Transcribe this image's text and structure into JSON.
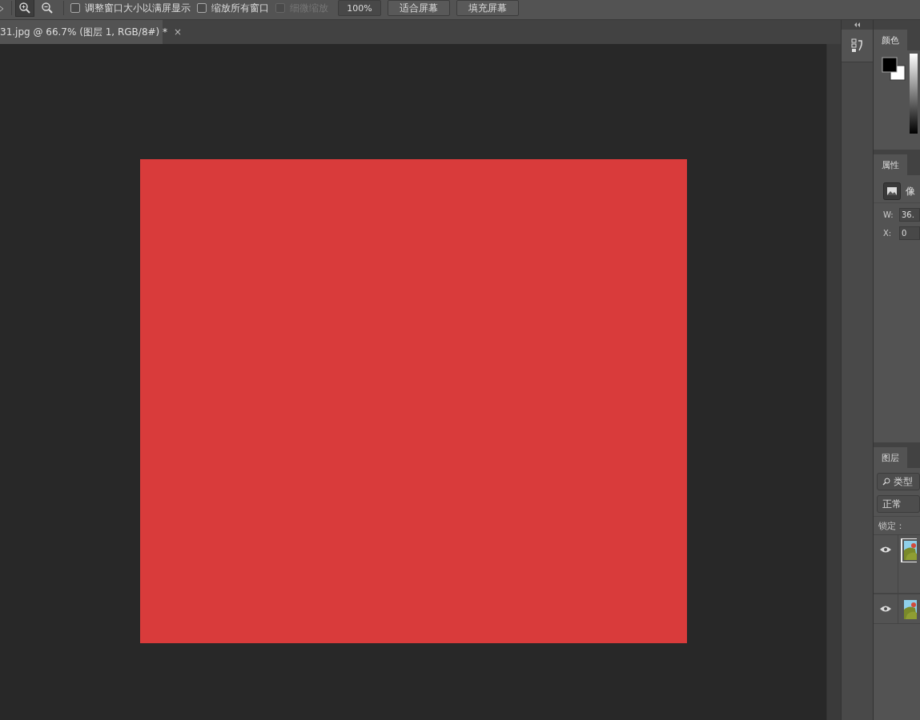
{
  "options_bar": {
    "zoom_tools": [
      {
        "kind": "zoom-in",
        "selected": true
      },
      {
        "kind": "zoom-out",
        "selected": false
      }
    ],
    "checkboxes": [
      {
        "label": "调整窗口大小以满屏显示",
        "checked": false,
        "disabled": false
      },
      {
        "label": "缩放所有窗口",
        "checked": false,
        "disabled": false
      },
      {
        "label": "细微缩放",
        "checked": false,
        "disabled": true
      }
    ],
    "zoom_value": "100%",
    "buttons": [
      "适合屏幕",
      "填充屏幕"
    ]
  },
  "document_tab": {
    "title": "31.jpg @ 66.7% (图层 1, RGB/8#) *",
    "close": "×"
  },
  "canvas": {
    "color": "#d93b3b"
  },
  "panels": {
    "color": {
      "tab": "颜色"
    },
    "properties": {
      "tab": "属性",
      "type_label": "像",
      "fields": [
        {
          "label": "W:",
          "value": "36."
        },
        {
          "label": "X:",
          "value": "0"
        }
      ]
    },
    "layers": {
      "tab": "图层",
      "filter": "类型",
      "blend_mode": "正常",
      "lock_label": "锁定：",
      "layers": [
        {
          "selected": true,
          "visible": true
        },
        {
          "selected": false,
          "visible": true
        }
      ]
    }
  }
}
